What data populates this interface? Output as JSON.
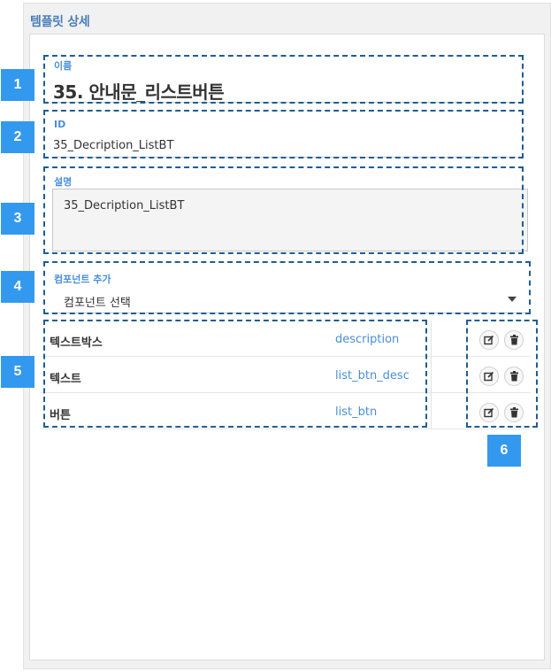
{
  "panel": {
    "title": "템플릿 상세"
  },
  "fields": {
    "name": {
      "label": "이름",
      "value": "35. 안내문_리스트버튼"
    },
    "id": {
      "label": "ID",
      "value": "35_Decription_ListBT"
    },
    "description": {
      "label": "설명",
      "value": "35_Decription_ListBT"
    },
    "component_add": {
      "label": "컴포넌트 추가",
      "selected": "컴포넌트 선택"
    }
  },
  "components": [
    {
      "type": "텍스트박스",
      "id": "description"
    },
    {
      "type": "텍스트",
      "id": "list_btn_desc"
    },
    {
      "type": "버튼",
      "id": "list_btn"
    }
  ],
  "annotations": [
    "1",
    "2",
    "3",
    "4",
    "5",
    "6"
  ],
  "colors": {
    "accent": "#4a8fd8",
    "badge": "#3399ee",
    "dash": "#1f5d93",
    "title": "#4a7fb8"
  },
  "icons": {
    "edit": "edit-icon",
    "delete": "trash-icon",
    "dropdown": "chevron-down-icon"
  }
}
